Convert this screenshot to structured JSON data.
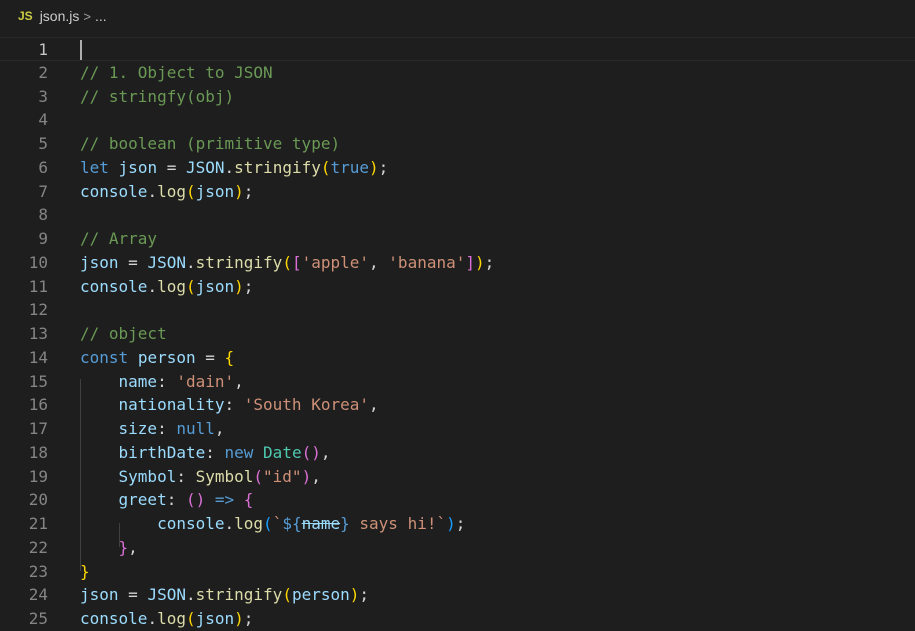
{
  "breadcrumb": {
    "file_badge": "JS",
    "file_name": "json.js",
    "separator": ">",
    "ellipsis": "..."
  },
  "editor": {
    "current_line": 1,
    "lines": [
      {
        "n": "1",
        "tokens": []
      },
      {
        "n": "2",
        "tokens": [
          [
            "comment",
            "// 1. Object to JSON"
          ]
        ]
      },
      {
        "n": "3",
        "tokens": [
          [
            "comment",
            "// stringfy(obj)"
          ]
        ]
      },
      {
        "n": "4",
        "tokens": []
      },
      {
        "n": "5",
        "tokens": [
          [
            "comment",
            "// boolean (primitive type)"
          ]
        ]
      },
      {
        "n": "6",
        "tokens": [
          [
            "keyword",
            "let"
          ],
          [
            "plain",
            " "
          ],
          [
            "variable",
            "json"
          ],
          [
            "plain",
            " = "
          ],
          [
            "variable",
            "JSON"
          ],
          [
            "plain",
            "."
          ],
          [
            "function",
            "stringify"
          ],
          [
            "bracket1",
            "("
          ],
          [
            "keyword",
            "true"
          ],
          [
            "bracket1",
            ")"
          ],
          [
            "plain",
            ";"
          ]
        ]
      },
      {
        "n": "7",
        "tokens": [
          [
            "variable",
            "console"
          ],
          [
            "plain",
            "."
          ],
          [
            "function",
            "log"
          ],
          [
            "bracket1",
            "("
          ],
          [
            "variable",
            "json"
          ],
          [
            "bracket1",
            ")"
          ],
          [
            "plain",
            ";"
          ]
        ]
      },
      {
        "n": "8",
        "tokens": []
      },
      {
        "n": "9",
        "tokens": [
          [
            "comment",
            "// Array"
          ]
        ]
      },
      {
        "n": "10",
        "tokens": [
          [
            "variable",
            "json"
          ],
          [
            "plain",
            " = "
          ],
          [
            "variable",
            "JSON"
          ],
          [
            "plain",
            "."
          ],
          [
            "function",
            "stringify"
          ],
          [
            "bracket1",
            "("
          ],
          [
            "bracket2",
            "["
          ],
          [
            "string",
            "'apple'"
          ],
          [
            "plain",
            ", "
          ],
          [
            "string",
            "'banana'"
          ],
          [
            "bracket2",
            "]"
          ],
          [
            "bracket1",
            ")"
          ],
          [
            "plain",
            ";"
          ]
        ]
      },
      {
        "n": "11",
        "tokens": [
          [
            "variable",
            "console"
          ],
          [
            "plain",
            "."
          ],
          [
            "function",
            "log"
          ],
          [
            "bracket1",
            "("
          ],
          [
            "variable",
            "json"
          ],
          [
            "bracket1",
            ")"
          ],
          [
            "plain",
            ";"
          ]
        ]
      },
      {
        "n": "12",
        "tokens": []
      },
      {
        "n": "13",
        "tokens": [
          [
            "comment",
            "// object"
          ]
        ]
      },
      {
        "n": "14",
        "tokens": [
          [
            "keyword",
            "const"
          ],
          [
            "plain",
            " "
          ],
          [
            "variable",
            "person"
          ],
          [
            "plain",
            " = "
          ],
          [
            "bracket1",
            "{"
          ]
        ]
      },
      {
        "n": "15",
        "tokens": [
          [
            "plain",
            "    "
          ],
          [
            "variable",
            "name"
          ],
          [
            "plain",
            ": "
          ],
          [
            "string",
            "'dain'"
          ],
          [
            "plain",
            ","
          ]
        ]
      },
      {
        "n": "16",
        "tokens": [
          [
            "plain",
            "    "
          ],
          [
            "variable",
            "nationality"
          ],
          [
            "plain",
            ": "
          ],
          [
            "string",
            "'South Korea'"
          ],
          [
            "plain",
            ","
          ]
        ]
      },
      {
        "n": "17",
        "tokens": [
          [
            "plain",
            "    "
          ],
          [
            "variable",
            "size"
          ],
          [
            "plain",
            ": "
          ],
          [
            "keyword",
            "null"
          ],
          [
            "plain",
            ","
          ]
        ]
      },
      {
        "n": "18",
        "tokens": [
          [
            "plain",
            "    "
          ],
          [
            "variable",
            "birthDate"
          ],
          [
            "plain",
            ": "
          ],
          [
            "keyword",
            "new"
          ],
          [
            "plain",
            " "
          ],
          [
            "class",
            "Date"
          ],
          [
            "bracket2",
            "()"
          ],
          [
            "plain",
            ","
          ]
        ]
      },
      {
        "n": "19",
        "tokens": [
          [
            "plain",
            "    "
          ],
          [
            "variable",
            "Symbol"
          ],
          [
            "plain",
            ": "
          ],
          [
            "function",
            "Symbol"
          ],
          [
            "bracket2",
            "("
          ],
          [
            "string",
            "\"id\""
          ],
          [
            "bracket2",
            ")"
          ],
          [
            "plain",
            ","
          ]
        ]
      },
      {
        "n": "20",
        "tokens": [
          [
            "plain",
            "    "
          ],
          [
            "variable",
            "greet"
          ],
          [
            "plain",
            ": "
          ],
          [
            "bracket2",
            "()"
          ],
          [
            "plain",
            " "
          ],
          [
            "keyword",
            "=>"
          ],
          [
            "plain",
            " "
          ],
          [
            "bracket2",
            "{"
          ]
        ]
      },
      {
        "n": "21",
        "tokens": [
          [
            "plain",
            "        "
          ],
          [
            "variable",
            "console"
          ],
          [
            "plain",
            "."
          ],
          [
            "function",
            "log"
          ],
          [
            "bracket3",
            "("
          ],
          [
            "string",
            "`"
          ],
          [
            "keyword",
            "${"
          ],
          [
            "deprecated",
            "name"
          ],
          [
            "keyword",
            "}"
          ],
          [
            "string",
            " says hi!`"
          ],
          [
            "bracket3",
            ")"
          ],
          [
            "plain",
            ";"
          ]
        ]
      },
      {
        "n": "22",
        "tokens": [
          [
            "plain",
            "    "
          ],
          [
            "bracket2",
            "}"
          ],
          [
            "plain",
            ","
          ]
        ]
      },
      {
        "n": "23",
        "tokens": [
          [
            "bracket1",
            "}"
          ]
        ]
      },
      {
        "n": "24",
        "tokens": [
          [
            "variable",
            "json"
          ],
          [
            "plain",
            " = "
          ],
          [
            "variable",
            "JSON"
          ],
          [
            "plain",
            "."
          ],
          [
            "function",
            "stringify"
          ],
          [
            "bracket1",
            "("
          ],
          [
            "variable",
            "person"
          ],
          [
            "bracket1",
            ")"
          ],
          [
            "plain",
            ";"
          ]
        ]
      },
      {
        "n": "25",
        "tokens": [
          [
            "variable",
            "console"
          ],
          [
            "plain",
            "."
          ],
          [
            "function",
            "log"
          ],
          [
            "bracket1",
            "("
          ],
          [
            "variable",
            "json"
          ],
          [
            "bracket1",
            ")"
          ],
          [
            "plain",
            ";"
          ]
        ]
      }
    ]
  }
}
